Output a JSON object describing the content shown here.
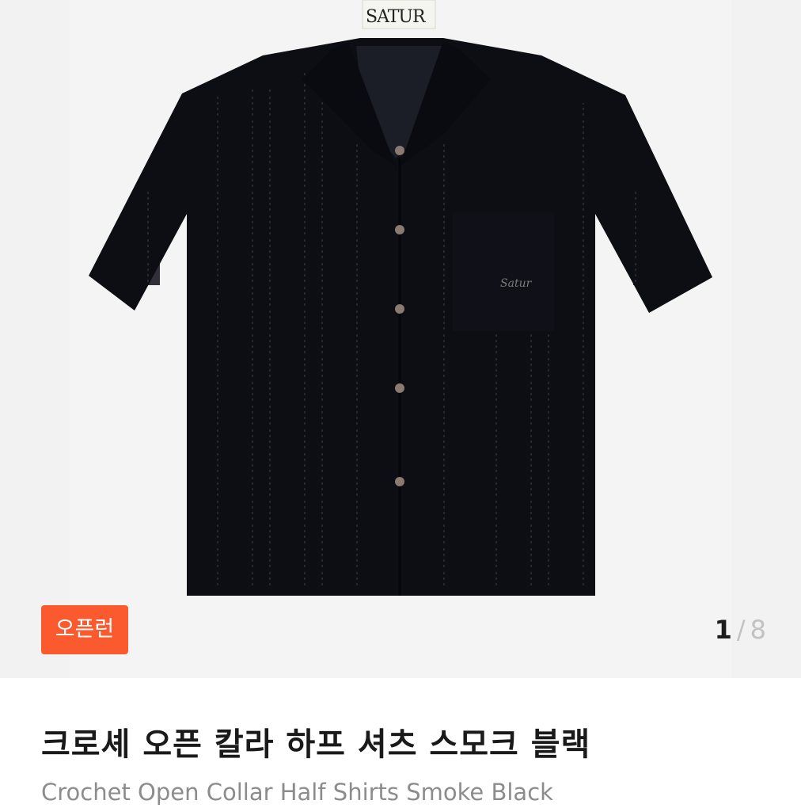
{
  "gallery": {
    "image_alt": "Crochet Open Collar Half Shirts Smoke Black",
    "label_text": "SATUR",
    "embroidery_text": "Satur",
    "badge": "오픈런",
    "counter": {
      "current": "1",
      "separator": "/",
      "total": "8"
    }
  },
  "product": {
    "title_ko": "크로셰 오픈 칼라 하프 셔츠 스모크 블랙",
    "title_en": "Crochet Open Collar Half Shirts Smoke Black"
  },
  "colors": {
    "badge_bg": "#fa5a2d",
    "shirt": "#0d0e14",
    "gallery_bg": "#f2f2f2"
  }
}
